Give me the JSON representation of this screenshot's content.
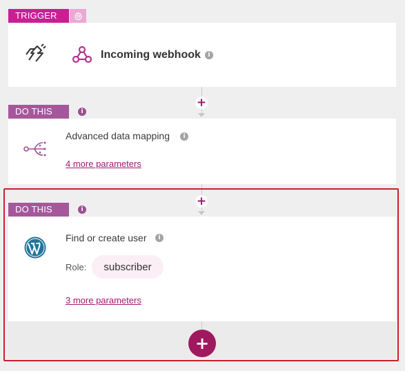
{
  "trigger": {
    "tag_label": "TRIGGER",
    "gear_icon": "gear-icon",
    "app_icon": "lightning-plug-icon",
    "webhook_icon": "webhook-icon",
    "title": "Incoming webhook",
    "info_icon": "info-icon"
  },
  "step1": {
    "tag_label": "DO THIS",
    "icon": "data-mapping-icon",
    "title": "Advanced data mapping",
    "params_link": "4 more parameters"
  },
  "step2": {
    "tag_label": "DO THIS",
    "icon": "wordpress-icon",
    "title": "Find or create user",
    "role_label": "Role:",
    "role_value": "subscriber",
    "params_link": "3 more parameters"
  },
  "colors": {
    "accent": "#a0195f",
    "trigger_tag": "#c81f93",
    "do_tag": "#a4589b",
    "highlight_border": "#c8202b"
  },
  "add_step_symbol": "+"
}
